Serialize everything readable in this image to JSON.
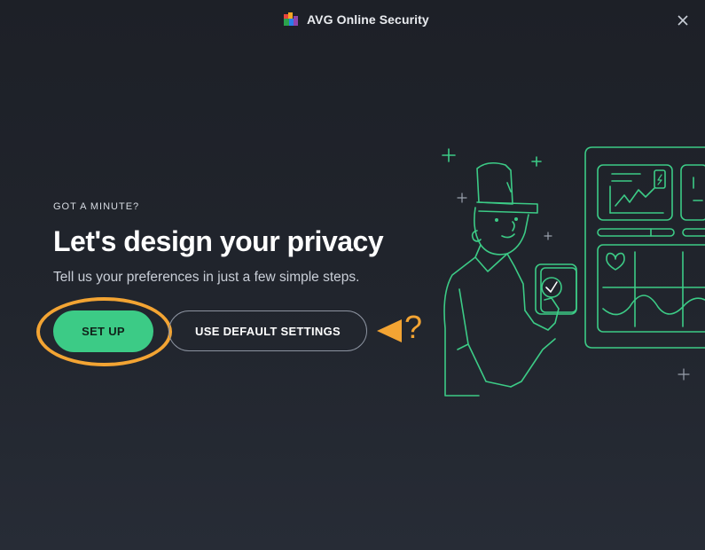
{
  "window": {
    "title": "AVG Online Security",
    "logo_icon": "avg-logo-icon",
    "close_icon": "close-icon"
  },
  "intro": {
    "eyebrow": "GOT A MINUTE?",
    "headline": "Let's design your privacy",
    "subtitle": "Tell us your preferences in just a few simple steps."
  },
  "actions": {
    "setup_label": "SET UP",
    "default_label": "USE DEFAULT SETTINGS"
  },
  "annotation": {
    "mark": "?",
    "color": "#f3a433"
  },
  "colors": {
    "accent": "#3ccb86",
    "background": "#1d2027",
    "highlight": "#f3a433"
  }
}
